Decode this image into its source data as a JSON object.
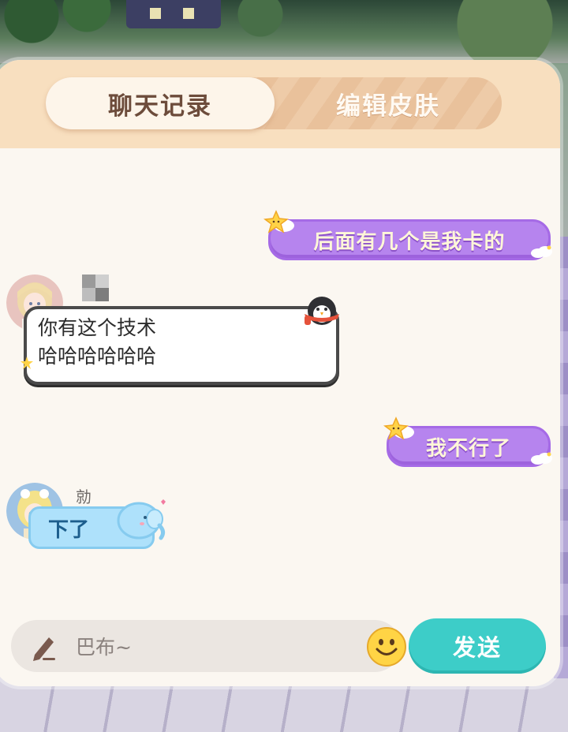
{
  "tabs": [
    {
      "label": "聊天记录",
      "active": true
    },
    {
      "label": "编辑皮肤",
      "active": false
    }
  ],
  "messages": [
    {
      "side": "right",
      "style": "purple-star",
      "text": "后面有几个是我卡的"
    },
    {
      "side": "left",
      "style": "white-penguin",
      "sender_name": "",
      "lines": [
        "你有这个技术",
        "哈哈哈哈哈哈"
      ]
    },
    {
      "side": "right",
      "style": "purple-star",
      "text": "我不行了"
    },
    {
      "side": "left",
      "style": "blue-elephant",
      "sender_name": "勍",
      "text": "下了"
    }
  ],
  "input": {
    "placeholder": "巴布~",
    "value": ""
  },
  "send_button": {
    "label": "发送"
  },
  "icons": {
    "compose": "pencil-icon",
    "emoji": "smiley-emoji-icon"
  },
  "colors": {
    "header_bg": "#f8dfbf",
    "panel_bg": "#fbf7f1",
    "purple_bubble": "#b684ee",
    "blue_bubble": "#aee1fb",
    "send_button": "#3dcdc8",
    "active_tab_text": "#6d4c3b"
  }
}
